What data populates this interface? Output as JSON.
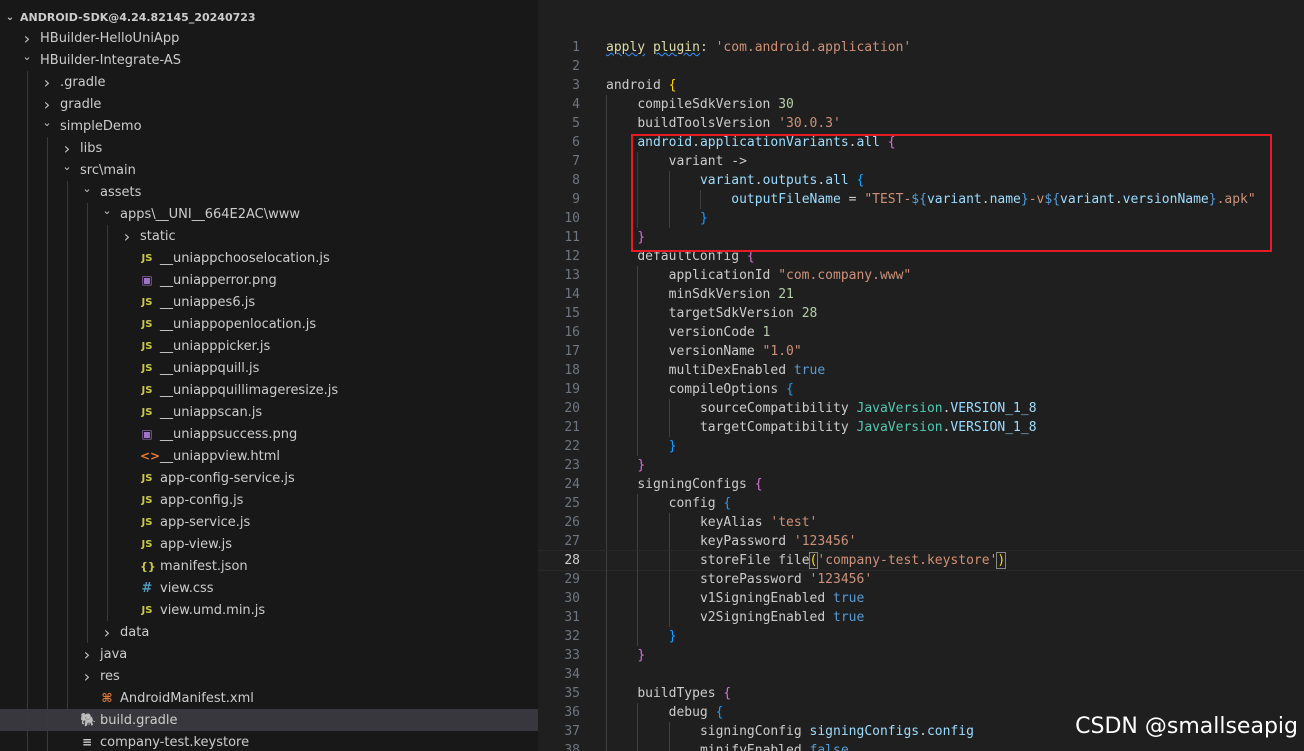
{
  "explorer": {
    "root_label": "ANDROID-SDK@4.24.82145_20240723",
    "items": [
      {
        "label": "HBuilder-HelloUniApp",
        "depth": 1,
        "kind": "folder",
        "expanded": false,
        "icon": "chevron-right-icon"
      },
      {
        "label": "HBuilder-Integrate-AS",
        "depth": 1,
        "kind": "folder",
        "expanded": true,
        "icon": "chevron-down-icon"
      },
      {
        "label": ".gradle",
        "depth": 2,
        "kind": "folder",
        "expanded": false,
        "icon": "chevron-right-icon"
      },
      {
        "label": "gradle",
        "depth": 2,
        "kind": "folder",
        "expanded": false,
        "icon": "chevron-right-icon"
      },
      {
        "label": "simpleDemo",
        "depth": 2,
        "kind": "folder",
        "expanded": true,
        "icon": "chevron-down-icon"
      },
      {
        "label": "libs",
        "depth": 3,
        "kind": "folder",
        "expanded": false,
        "icon": "chevron-right-icon"
      },
      {
        "label": "src\\main",
        "depth": 3,
        "kind": "folder",
        "expanded": true,
        "icon": "chevron-down-icon"
      },
      {
        "label": "assets",
        "depth": 4,
        "kind": "folder",
        "expanded": true,
        "icon": "chevron-down-icon"
      },
      {
        "label": "apps\\__UNI__664E2AC\\www",
        "depth": 5,
        "kind": "folder",
        "expanded": true,
        "icon": "chevron-down-icon"
      },
      {
        "label": "static",
        "depth": 6,
        "kind": "folder",
        "expanded": false,
        "icon": "chevron-right-icon"
      },
      {
        "label": "__uniappchooselocation.js",
        "depth": 6,
        "kind": "js",
        "icon": "js-file-icon"
      },
      {
        "label": "__uniapperror.png",
        "depth": 6,
        "kind": "img",
        "icon": "image-file-icon"
      },
      {
        "label": "__uniappes6.js",
        "depth": 6,
        "kind": "js",
        "icon": "js-file-icon"
      },
      {
        "label": "__uniappopenlocation.js",
        "depth": 6,
        "kind": "js",
        "icon": "js-file-icon"
      },
      {
        "label": "__uniapppicker.js",
        "depth": 6,
        "kind": "js",
        "icon": "js-file-icon"
      },
      {
        "label": "__uniappquill.js",
        "depth": 6,
        "kind": "js",
        "icon": "js-file-icon"
      },
      {
        "label": "__uniappquillimageresize.js",
        "depth": 6,
        "kind": "js",
        "icon": "js-file-icon"
      },
      {
        "label": "__uniappscan.js",
        "depth": 6,
        "kind": "js",
        "icon": "js-file-icon"
      },
      {
        "label": "__uniappsuccess.png",
        "depth": 6,
        "kind": "img",
        "icon": "image-file-icon"
      },
      {
        "label": "__uniappview.html",
        "depth": 6,
        "kind": "html",
        "icon": "html-file-icon"
      },
      {
        "label": "app-config-service.js",
        "depth": 6,
        "kind": "js",
        "icon": "js-file-icon"
      },
      {
        "label": "app-config.js",
        "depth": 6,
        "kind": "js",
        "icon": "js-file-icon"
      },
      {
        "label": "app-service.js",
        "depth": 6,
        "kind": "js",
        "icon": "js-file-icon"
      },
      {
        "label": "app-view.js",
        "depth": 6,
        "kind": "js",
        "icon": "js-file-icon"
      },
      {
        "label": "manifest.json",
        "depth": 6,
        "kind": "json",
        "icon": "json-file-icon"
      },
      {
        "label": "view.css",
        "depth": 6,
        "kind": "css",
        "icon": "css-file-icon"
      },
      {
        "label": "view.umd.min.js",
        "depth": 6,
        "kind": "js",
        "icon": "js-file-icon"
      },
      {
        "label": "data",
        "depth": 5,
        "kind": "folder",
        "expanded": false,
        "icon": "chevron-right-icon"
      },
      {
        "label": "java",
        "depth": 4,
        "kind": "folder",
        "expanded": false,
        "icon": "chevron-right-icon"
      },
      {
        "label": "res",
        "depth": 4,
        "kind": "folder",
        "expanded": false,
        "icon": "chevron-right-icon"
      },
      {
        "label": "AndroidManifest.xml",
        "depth": 4,
        "kind": "xml",
        "icon": "xml-file-icon"
      },
      {
        "label": "build.gradle",
        "depth": 3,
        "kind": "gradle",
        "selected": true,
        "icon": "gradle-file-icon"
      },
      {
        "label": "company-test.keystore",
        "depth": 3,
        "kind": "key",
        "icon": "keystore-file-icon"
      }
    ]
  },
  "icons": {
    "js": "JS",
    "json": "{}",
    "css": "#",
    "img": "▣",
    "html": "<>",
    "xml": "⌘",
    "gradle": "🐘",
    "key": "≡"
  },
  "editor": {
    "current_line": 28,
    "lines": [
      {
        "n": 1,
        "indent": 0,
        "tokens": [
          [
            "apply",
            "k-fn squiggle"
          ],
          [
            " ",
            ""
          ],
          [
            "plugin",
            "k-fn squiggle"
          ],
          [
            ": ",
            "k-plain"
          ],
          [
            "'com.android.application'",
            "k-str"
          ]
        ]
      },
      {
        "n": 2,
        "indent": 0,
        "tokens": []
      },
      {
        "n": 3,
        "indent": 0,
        "tokens": [
          [
            "android",
            "k-plain"
          ],
          [
            " ",
            ""
          ],
          [
            "{",
            "k-b1"
          ]
        ]
      },
      {
        "n": 4,
        "indent": 1,
        "tokens": [
          [
            "compileSdkVersion",
            "k-plain"
          ],
          [
            " ",
            ""
          ],
          [
            "30",
            "k-num"
          ]
        ]
      },
      {
        "n": 5,
        "indent": 1,
        "tokens": [
          [
            "buildToolsVersion",
            "k-plain"
          ],
          [
            " ",
            ""
          ],
          [
            "'30.0.3'",
            "k-str"
          ]
        ]
      },
      {
        "n": 6,
        "indent": 1,
        "tokens": [
          [
            "android",
            "k-id"
          ],
          [
            ".",
            "k-plain"
          ],
          [
            "applicationVariants",
            "k-id"
          ],
          [
            ".",
            "k-plain"
          ],
          [
            "all",
            "k-id"
          ],
          [
            " ",
            ""
          ],
          [
            "{",
            "k-b2"
          ]
        ]
      },
      {
        "n": 7,
        "indent": 2,
        "tokens": [
          [
            "variant",
            "k-plain"
          ],
          [
            " ->",
            "k-plain"
          ]
        ]
      },
      {
        "n": 8,
        "indent": 3,
        "tokens": [
          [
            "variant",
            "k-id"
          ],
          [
            ".",
            "k-plain"
          ],
          [
            "outputs",
            "k-id"
          ],
          [
            ".",
            "k-plain"
          ],
          [
            "all",
            "k-id"
          ],
          [
            " ",
            ""
          ],
          [
            "{",
            "k-b3"
          ]
        ]
      },
      {
        "n": 9,
        "indent": 4,
        "tokens": [
          [
            "outputFileName",
            "k-id"
          ],
          [
            " = ",
            "k-plain"
          ],
          [
            "\"TEST-",
            "k-str"
          ],
          [
            "${",
            "k-tmpl"
          ],
          [
            "variant",
            "k-id"
          ],
          [
            ".",
            "k-plain"
          ],
          [
            "name",
            "k-id"
          ],
          [
            "}",
            "k-tmpl"
          ],
          [
            "-v",
            "k-str"
          ],
          [
            "${",
            "k-tmpl"
          ],
          [
            "variant",
            "k-id"
          ],
          [
            ".",
            "k-plain"
          ],
          [
            "versionName",
            "k-id"
          ],
          [
            "}",
            "k-tmpl"
          ],
          [
            ".apk\"",
            "k-str"
          ]
        ]
      },
      {
        "n": 10,
        "indent": 3,
        "tokens": [
          [
            "}",
            "k-b3"
          ]
        ]
      },
      {
        "n": 11,
        "indent": 1,
        "tokens": [
          [
            "}",
            "k-b2"
          ]
        ]
      },
      {
        "n": 12,
        "indent": 1,
        "tokens": [
          [
            "defaultConfig",
            "k-plain"
          ],
          [
            " ",
            ""
          ],
          [
            "{",
            "k-b2"
          ]
        ]
      },
      {
        "n": 13,
        "indent": 2,
        "tokens": [
          [
            "applicationId",
            "k-plain"
          ],
          [
            " ",
            ""
          ],
          [
            "\"com.company.www\"",
            "k-str"
          ]
        ]
      },
      {
        "n": 14,
        "indent": 2,
        "tokens": [
          [
            "minSdkVersion",
            "k-plain"
          ],
          [
            " ",
            ""
          ],
          [
            "21",
            "k-num"
          ]
        ]
      },
      {
        "n": 15,
        "indent": 2,
        "tokens": [
          [
            "targetSdkVersion",
            "k-plain"
          ],
          [
            " ",
            ""
          ],
          [
            "28",
            "k-num"
          ]
        ]
      },
      {
        "n": 16,
        "indent": 2,
        "tokens": [
          [
            "versionCode",
            "k-plain"
          ],
          [
            " ",
            ""
          ],
          [
            "1",
            "k-num"
          ]
        ]
      },
      {
        "n": 17,
        "indent": 2,
        "tokens": [
          [
            "versionName",
            "k-plain"
          ],
          [
            " ",
            ""
          ],
          [
            "\"1.0\"",
            "k-str"
          ]
        ]
      },
      {
        "n": 18,
        "indent": 2,
        "tokens": [
          [
            "multiDexEnabled",
            "k-plain"
          ],
          [
            " ",
            ""
          ],
          [
            "true",
            "k-bool"
          ]
        ]
      },
      {
        "n": 19,
        "indent": 2,
        "tokens": [
          [
            "compileOptions",
            "k-plain"
          ],
          [
            " ",
            ""
          ],
          [
            "{",
            "k-b3"
          ]
        ]
      },
      {
        "n": 20,
        "indent": 3,
        "tokens": [
          [
            "sourceCompatibility",
            "k-plain"
          ],
          [
            " ",
            ""
          ],
          [
            "JavaVersion",
            "k-type"
          ],
          [
            ".",
            "k-plain"
          ],
          [
            "VERSION_1_8",
            "k-id"
          ]
        ]
      },
      {
        "n": 21,
        "indent": 3,
        "tokens": [
          [
            "targetCompatibility",
            "k-plain"
          ],
          [
            " ",
            ""
          ],
          [
            "JavaVersion",
            "k-type"
          ],
          [
            ".",
            "k-plain"
          ],
          [
            "VERSION_1_8",
            "k-id"
          ]
        ]
      },
      {
        "n": 22,
        "indent": 2,
        "tokens": [
          [
            "}",
            "k-b3"
          ]
        ]
      },
      {
        "n": 23,
        "indent": 1,
        "tokens": [
          [
            "}",
            "k-b2"
          ]
        ]
      },
      {
        "n": 24,
        "indent": 1,
        "tokens": [
          [
            "signingConfigs",
            "k-plain"
          ],
          [
            " ",
            ""
          ],
          [
            "{",
            "k-b2"
          ]
        ]
      },
      {
        "n": 25,
        "indent": 2,
        "tokens": [
          [
            "config",
            "k-plain"
          ],
          [
            " ",
            ""
          ],
          [
            "{",
            "k-b3"
          ]
        ]
      },
      {
        "n": 26,
        "indent": 3,
        "tokens": [
          [
            "keyAlias",
            "k-plain"
          ],
          [
            " ",
            ""
          ],
          [
            "'test'",
            "k-str"
          ]
        ]
      },
      {
        "n": 27,
        "indent": 3,
        "tokens": [
          [
            "keyPassword",
            "k-plain"
          ],
          [
            " ",
            ""
          ],
          [
            "'123456'",
            "k-str"
          ]
        ]
      },
      {
        "n": 28,
        "indent": 3,
        "tokens": [
          [
            "storeFile",
            "k-plain"
          ],
          [
            " ",
            ""
          ],
          [
            "file",
            "k-plain"
          ],
          [
            "(",
            "k-b1 bracket-match"
          ],
          [
            "'company-test.keystore'",
            "k-str"
          ],
          [
            ")",
            "k-b1 bracket-match"
          ]
        ]
      },
      {
        "n": 29,
        "indent": 3,
        "tokens": [
          [
            "storePassword",
            "k-plain"
          ],
          [
            " ",
            ""
          ],
          [
            "'123456'",
            "k-str"
          ]
        ]
      },
      {
        "n": 30,
        "indent": 3,
        "tokens": [
          [
            "v1SigningEnabled",
            "k-plain"
          ],
          [
            " ",
            ""
          ],
          [
            "true",
            "k-bool"
          ]
        ]
      },
      {
        "n": 31,
        "indent": 3,
        "tokens": [
          [
            "v2SigningEnabled",
            "k-plain"
          ],
          [
            " ",
            ""
          ],
          [
            "true",
            "k-bool"
          ]
        ]
      },
      {
        "n": 32,
        "indent": 2,
        "tokens": [
          [
            "}",
            "k-b3"
          ]
        ]
      },
      {
        "n": 33,
        "indent": 1,
        "tokens": [
          [
            "}",
            "k-b2"
          ]
        ]
      },
      {
        "n": 34,
        "indent": 1,
        "tokens": []
      },
      {
        "n": 35,
        "indent": 1,
        "tokens": [
          [
            "buildTypes",
            "k-plain"
          ],
          [
            " ",
            ""
          ],
          [
            "{",
            "k-b2"
          ]
        ]
      },
      {
        "n": 36,
        "indent": 2,
        "tokens": [
          [
            "debug",
            "k-plain"
          ],
          [
            " ",
            ""
          ],
          [
            "{",
            "k-b3"
          ]
        ]
      },
      {
        "n": 37,
        "indent": 3,
        "tokens": [
          [
            "signingConfig",
            "k-plain"
          ],
          [
            " ",
            ""
          ],
          [
            "signingConfigs",
            "k-id"
          ],
          [
            ".",
            "k-plain"
          ],
          [
            "config",
            "k-id"
          ]
        ]
      },
      {
        "n": 38,
        "indent": 3,
        "tokens": [
          [
            "minifyEnabled",
            "k-plain"
          ],
          [
            " ",
            ""
          ],
          [
            "false",
            "k-bool"
          ]
        ]
      }
    ]
  },
  "watermark": "CSDN @smallseapig"
}
